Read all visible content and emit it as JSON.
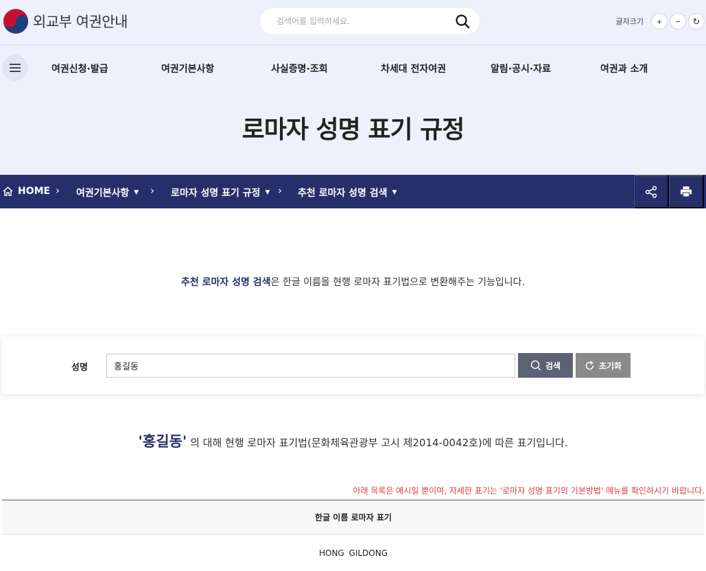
{
  "header": {
    "logo_text": "외교부 여권안내",
    "search_placeholder": "검색어를 입력하세요.",
    "font_size_label": "글자크기",
    "font_plus": "+",
    "font_minus": "−",
    "font_reset": "↻"
  },
  "nav": {
    "items": [
      "여권신청·발급",
      "여권기본사항",
      "사실증명·조회",
      "차세대 전자여권",
      "알림·공시·자료",
      "여권과 소개"
    ]
  },
  "page_title": "로마자 성명 표기 규정",
  "breadcrumb": {
    "home": "HOME",
    "items": [
      "여권기본사항",
      "로마자 성명 표기 규정",
      "추천 로마자 성명 검색"
    ]
  },
  "intro": {
    "highlight": "추천 로마자 성명 검색",
    "rest": "은 한글 이름을 현행 로마자 표기법으로 변환해주는 기능입니다."
  },
  "search_form": {
    "label": "성명",
    "value": "홍길동",
    "search_label": "검색",
    "reset_label": "초기화"
  },
  "result": {
    "name": "'홍길동'",
    "text": " 의 대해 현행 로마자 표기법(문화체육관광부 고시 제2014-0042호)에 따른 표기입니다."
  },
  "notice": "아래 목록은 예시일 뿐이며, 자세한 표기는 '로마자 성명 표기의 기본방법' 메뉴를 확인하시기 바랍니다.",
  "table": {
    "header": "한글 이름 로마자 표기",
    "rows": [
      "HONG  GILDONG"
    ]
  },
  "colors": {
    "accent": "#262f6a",
    "header_bg": "#eef0fc",
    "notice": "#d9413e"
  }
}
